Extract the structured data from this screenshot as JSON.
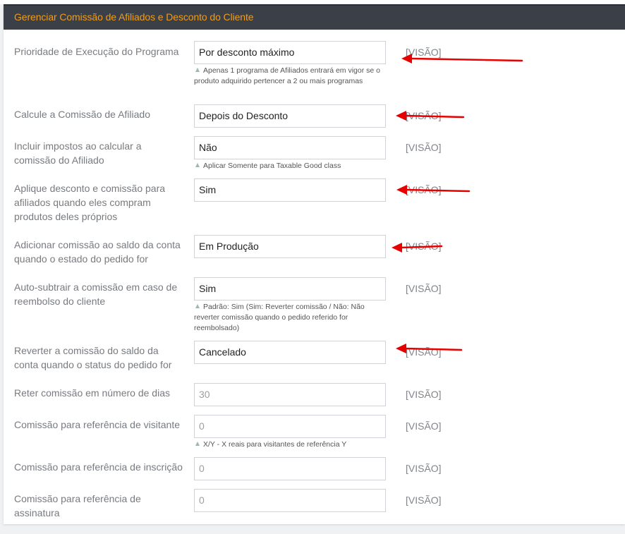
{
  "header": {
    "title": "Gerenciar Comissão de Afiliados e Desconto do Cliente"
  },
  "rows": [
    {
      "label": "Prioridade de Execução do Programa",
      "value": "Por desconto máximo",
      "visao": "[VISÃO]",
      "hint": "Apenas 1 programa de Afiliados entrará em vigor se o produto adquirido pertencer a 2 ou mais programas"
    },
    {
      "label": "Calcule a Comissão de Afiliado",
      "value": "Depois do Desconto",
      "visao": "[VISÃO]"
    },
    {
      "label": "Incluir impostos ao calcular a comissão do Afiliado",
      "value": "Não",
      "visao": "[VISÃO]",
      "hint": "Aplicar Somente para Taxable Good class"
    },
    {
      "label": "Aplique desconto e comissão para afiliados quando eles compram produtos deles próprios",
      "value": "Sim",
      "visao": "[VISÃO]"
    },
    {
      "label": "Adicionar comissão ao saldo da conta quando o estado do pedido for",
      "value": "Em Produção",
      "visao": "[VISÃO]"
    },
    {
      "label": "Auto-subtrair a comissão em caso de reembolso do cliente",
      "value": "Sim",
      "visao": "[VISÃO]",
      "hint": "Padrão: Sim (Sim: Reverter comissão / Não: Não reverter comissão quando o pedido referido for reembolsado)"
    },
    {
      "label": "Reverter a comissão do saldo da conta quando o status do pedido for",
      "value": "Cancelado",
      "visao": "[VISÃO]"
    },
    {
      "label": "Reter comissão em número de dias",
      "value": "30",
      "visao": "[VISÃO]"
    },
    {
      "label": "Comissão para referência de visitante",
      "value": "0",
      "visao": "[VISÃO]",
      "hint": "X/Y - X reais para visitantes de referência Y"
    },
    {
      "label": "Comissão para referência de inscrição",
      "value": "0",
      "visao": "[VISÃO]"
    },
    {
      "label": "Comissão para referência de assinatura",
      "value": "0",
      "visao": "[VISÃO]"
    }
  ],
  "colors": {
    "header_bg": "#3a3f48",
    "title": "#f39c12",
    "arrow": "#e60000"
  }
}
